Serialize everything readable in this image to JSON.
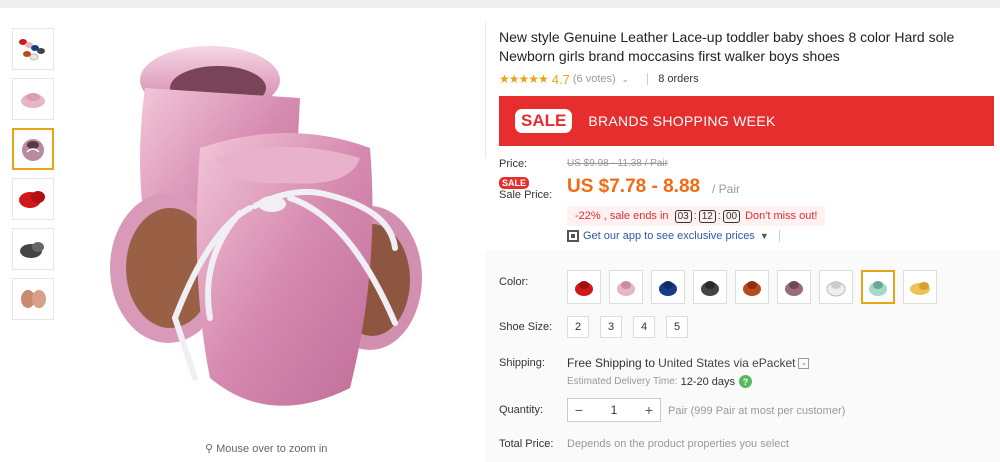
{
  "product": {
    "title": "New style Genuine Leather Lace-up toddler baby shoes 8 color Hard sole Newborn girls brand moccasins first walker boys shoes",
    "stars": "★★★★★",
    "rating": "4.7",
    "votes": "(6 votes)",
    "orders": "8 orders"
  },
  "banner": {
    "sale": "SALE",
    "text": "BRANDS SHOPPING WEEK",
    "color": "#e62e2e"
  },
  "price": {
    "label": "Price:",
    "old": "US $9.98 - 11.38 / Pair",
    "sale_badge": "SALE",
    "sale_label": "Sale Price:",
    "sale": "US $7.78 - 8.88",
    "unit": "/ Pair",
    "discount_text": "-22% , sale ends in",
    "timer": [
      "03",
      "12",
      "00"
    ],
    "dont_miss": "Don't miss out!",
    "app_link": "Get our app to see exclusive prices"
  },
  "color": {
    "label": "Color:",
    "swatches": [
      "#d01818",
      "#e6b7c3",
      "#1a3a8a",
      "#444444",
      "#b84a1e",
      "#9a6b7a",
      "#e8e8e8",
      "#a8d8c8",
      "#f0c05a"
    ],
    "selected_index": 7
  },
  "size": {
    "label": "Shoe Size:",
    "options": [
      "2",
      "3",
      "4",
      "5"
    ]
  },
  "shipping": {
    "label": "Shipping:",
    "free": "Free Shipping to",
    "dest": "United States via ePacket",
    "delivery_label": "Estimated Delivery Time:",
    "delivery_days": "12-20 days"
  },
  "quantity": {
    "label": "Quantity:",
    "minus": "−",
    "value": "1",
    "plus": "+",
    "note": "Pair (999 Pair at most per customer)"
  },
  "total": {
    "label": "Total Price:",
    "note": "Depends on the product properties you select"
  },
  "gallery": {
    "zoom_hint": "Mouse over to zoom in",
    "active_index": 2
  },
  "accent": "#e8a317",
  "price_color": "#f36a12"
}
